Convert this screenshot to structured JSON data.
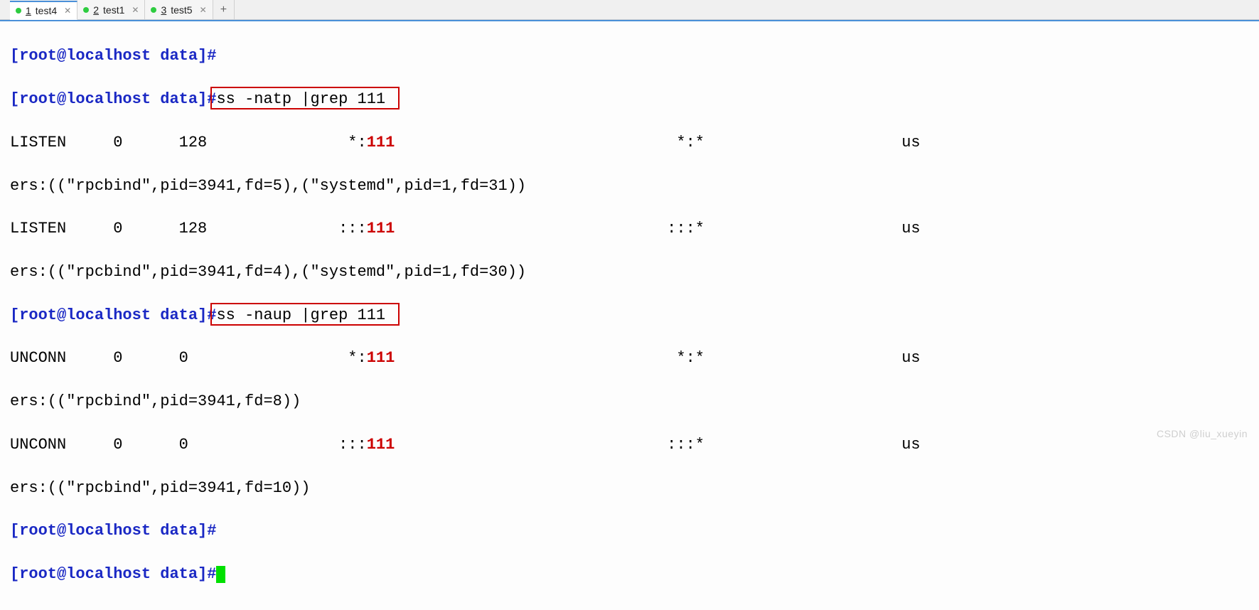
{
  "tabs": [
    {
      "num": "1",
      "name": "test4",
      "active": true
    },
    {
      "num": "2",
      "name": "test1",
      "active": false
    },
    {
      "num": "3",
      "name": "test5",
      "active": false
    }
  ],
  "prompt": {
    "open": "[",
    "user": "root",
    "at": "@",
    "host": "localhost",
    "sp": " ",
    "dir": "data",
    "close": "]",
    "hash": "#"
  },
  "cmd1": "ss -natp |grep 111",
  "cmd2": "ss -naup |grep 111",
  "out": {
    "l1a": "LISTEN     0      128               *:",
    "l1port": "111",
    "l1b": "                              *:*                     us",
    "l2": "ers:((\"rpcbind\",pid=3941,fd=5),(\"systemd\",pid=1,fd=31))",
    "l3a": "LISTEN     0      128              :::",
    "l3port": "111",
    "l3b": "                             :::*                     us",
    "l4": "ers:((\"rpcbind\",pid=3941,fd=4),(\"systemd\",pid=1,fd=30))",
    "u1a": "UNCONN     0      0                 *:",
    "u1port": "111",
    "u1b": "                              *:*                     us",
    "u2": "ers:((\"rpcbind\",pid=3941,fd=8))",
    "u3a": "UNCONN     0      0                :::",
    "u3port": "111",
    "u3b": "                             :::*                     us",
    "u4": "ers:((\"rpcbind\",pid=3941,fd=10))"
  },
  "watermark": "CSDN @liu_xueyin"
}
